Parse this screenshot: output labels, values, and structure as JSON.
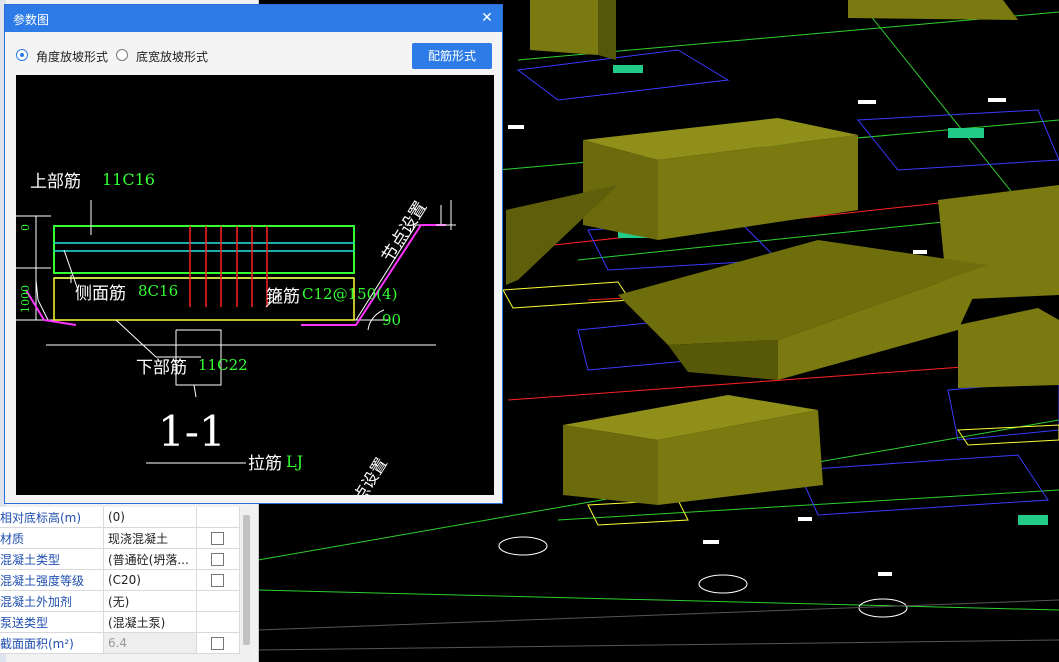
{
  "dialog": {
    "title": "参数图",
    "close_glyph": "✕",
    "radio_angle": "角度放坡形式",
    "radio_width": "底宽放坡形式",
    "selected_radio": "radio_angle",
    "rebar_button": "配筋形式"
  },
  "drawing": {
    "top_label": "上部筋",
    "top_value": "11C16",
    "side_label": "侧面筋",
    "side_value": "8C16",
    "stirrup_label": "箍筋",
    "stirrup_value": "C12@150(4)",
    "bottom_label": "下部筋",
    "bottom_value": "11C22",
    "node_setting": "节点设置",
    "node_setting_partial": "点设置",
    "angle_value": "90",
    "dim_top": "0",
    "dim_side": "1000",
    "section_label": "1-1",
    "tie_label": "拉筋",
    "tie_value": "LJ"
  },
  "properties": {
    "rows": [
      {
        "name": "相对底标高(m)",
        "value": "(0)",
        "has_checkbox": false
      },
      {
        "name": "材质",
        "value": "现浇混凝土",
        "has_checkbox": true
      },
      {
        "name": "混凝土类型",
        "value": "(普通砼(坍落...",
        "has_checkbox": true
      },
      {
        "name": "混凝土强度等级",
        "value": "(C20)",
        "has_checkbox": true
      },
      {
        "name": "混凝土外加剂",
        "value": "(无)",
        "has_checkbox": false
      },
      {
        "name": "泵送类型",
        "value": "(混凝土泵)",
        "has_checkbox": false
      },
      {
        "name": "截面面积(m²)",
        "value": "6.4",
        "has_checkbox": true
      }
    ]
  },
  "colors": {
    "title_bar": "#2d7be6",
    "cad_green": "#33ff33",
    "cad_cyan": "#22e6e6",
    "cad_yellow": "#ffff33",
    "cad_red": "#ff2020",
    "cad_magenta": "#ff33ff",
    "footing_olive": "#7a7a10"
  }
}
